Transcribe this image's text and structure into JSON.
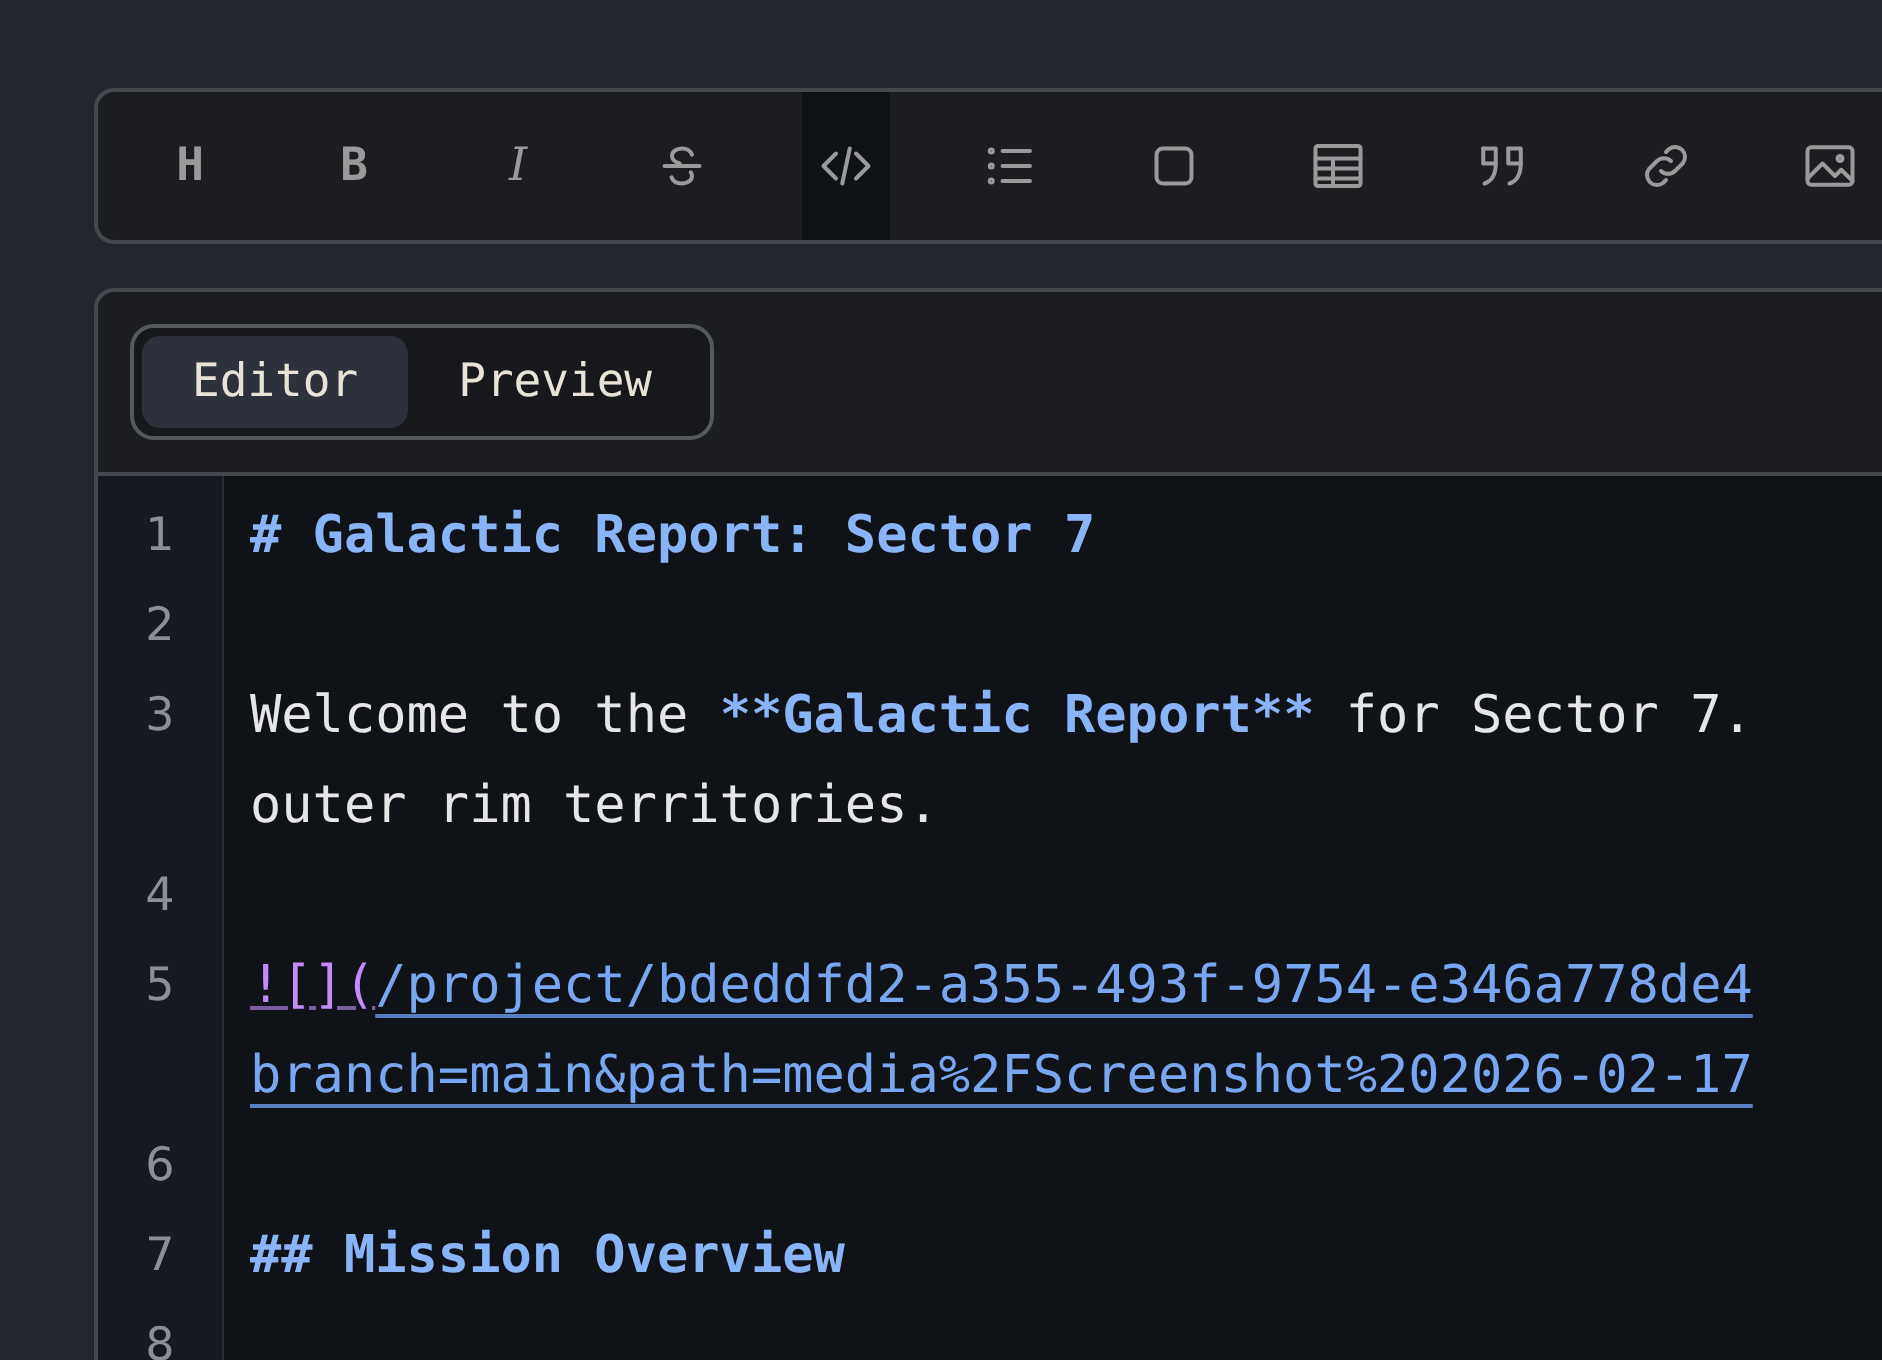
{
  "toolbar": [
    {
      "kind": "heading",
      "label": "H"
    },
    {
      "kind": "bold",
      "label": "B"
    },
    {
      "kind": "italic",
      "label": "I"
    },
    {
      "kind": "strike"
    },
    {
      "kind": "code"
    },
    {
      "kind": "list"
    },
    {
      "kind": "checkbox"
    },
    {
      "kind": "table"
    },
    {
      "kind": "quote"
    },
    {
      "kind": "link"
    },
    {
      "kind": "image"
    }
  ],
  "tabs": [
    {
      "label": "Editor",
      "selected": true
    },
    {
      "label": "Preview",
      "selected": false
    }
  ],
  "lines": [
    {
      "number": "1",
      "rows": [
        [
          {
            "kind": "heading",
            "text": "# Galactic Report: Sector 7"
          }
        ]
      ]
    },
    {
      "number": "2"
    },
    {
      "number": "3",
      "rows": [
        [
          {
            "kind": "plain",
            "text": "Welcome to the "
          },
          {
            "kind": "bold",
            "text": "**Galactic Report**"
          },
          {
            "kind": "plain",
            "text": " for Sector 7."
          }
        ],
        [
          {
            "kind": "plain",
            "text": "outer rim territories."
          }
        ]
      ]
    },
    {
      "number": "4"
    },
    {
      "number": "5",
      "rows": [
        [
          {
            "kind": "punct",
            "text": "![]("
          },
          {
            "kind": "url",
            "text": "/project/bdeddfd2-a355-493f-9754-e346a778de4"
          }
        ],
        [
          {
            "kind": "url",
            "text": "branch=main&path=media%2FScreenshot%202026-02-17"
          }
        ]
      ]
    },
    {
      "number": "6"
    },
    {
      "number": "7",
      "rows": [
        [
          {
            "kind": "heading",
            "text": "## Mission Overview"
          }
        ]
      ]
    },
    {
      "number": "8"
    }
  ]
}
